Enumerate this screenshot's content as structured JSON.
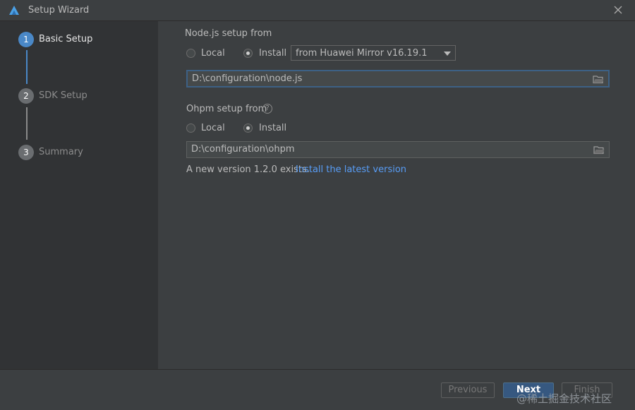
{
  "window": {
    "title": "Setup Wizard",
    "app_icon": "huawei-devstudio-logo",
    "close_icon": "close-icon"
  },
  "steps": [
    {
      "number": "1",
      "label": "Basic Setup",
      "state": "active"
    },
    {
      "number": "2",
      "label": "SDK Setup",
      "state": "pending"
    },
    {
      "number": "3",
      "label": "Summary",
      "state": "pending"
    }
  ],
  "nodejs": {
    "section_label": "Node.js setup from",
    "option_local": "Local",
    "option_install": "Install",
    "selected": "Install",
    "mirror_select_value": "from Huawei Mirror v16.19.1",
    "path_value": "D:\\configuration\\node.js"
  },
  "ohpm": {
    "section_label": "Ohpm setup from",
    "help_icon_glyph": "?",
    "option_local": "Local",
    "option_install": "Install",
    "selected": "Install",
    "path_value": "D:\\configuration\\ohpm",
    "notice_text": "A new version 1.2.0 exists.",
    "notice_link": "Install the latest version"
  },
  "footer": {
    "previous_label": "Previous",
    "next_label": "Next",
    "finish_label": "Finish"
  },
  "watermark": "@稀土掘金技术社区",
  "colors": {
    "background": "#3c3f41",
    "sidebar": "#313335",
    "accent": "#4a88c7",
    "link": "#589df6",
    "primary_button": "#365880"
  }
}
